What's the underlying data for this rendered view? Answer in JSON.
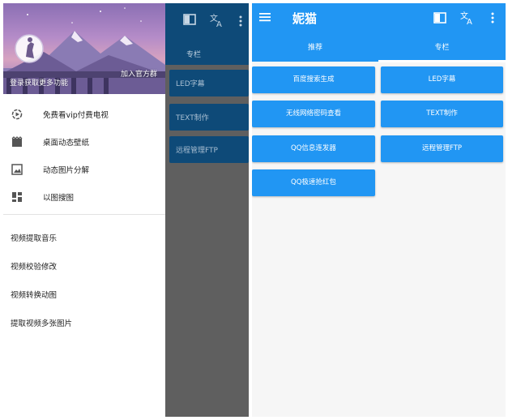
{
  "left": {
    "tab_label": "专栏",
    "cards": [
      "LED字幕",
      "TEXT制作",
      "远程管理FTP"
    ],
    "drawer": {
      "join_group": "加入官方群",
      "login_prompt": "登录获取更多功能",
      "items": [
        {
          "label": "免费看vip付费电视",
          "icon": "play-circle-icon"
        },
        {
          "label": "桌面动态壁纸",
          "icon": "movie-clapper-icon"
        },
        {
          "label": "动态图片分解",
          "icon": "image-icon"
        },
        {
          "label": "以图搜图",
          "icon": "dashboard-grid-icon"
        }
      ],
      "video_items": [
        "视频提取音乐",
        "视频校验修改",
        "视频转换动图",
        "提取视频多张图片"
      ]
    }
  },
  "right": {
    "app_title": "妮猫",
    "tabs": [
      "推荐",
      "专栏"
    ],
    "buttons": [
      "百度搜索生成",
      "LED字幕",
      "无线网络密码查看",
      "TEXT制作",
      "QQ信息连发器",
      "远程管理FTP",
      "QQ极速抢红包"
    ]
  },
  "colors": {
    "primary": "#2196f3",
    "dark_primary_dimmed": "#0e4a78",
    "scrim": "#5f5f5f"
  }
}
